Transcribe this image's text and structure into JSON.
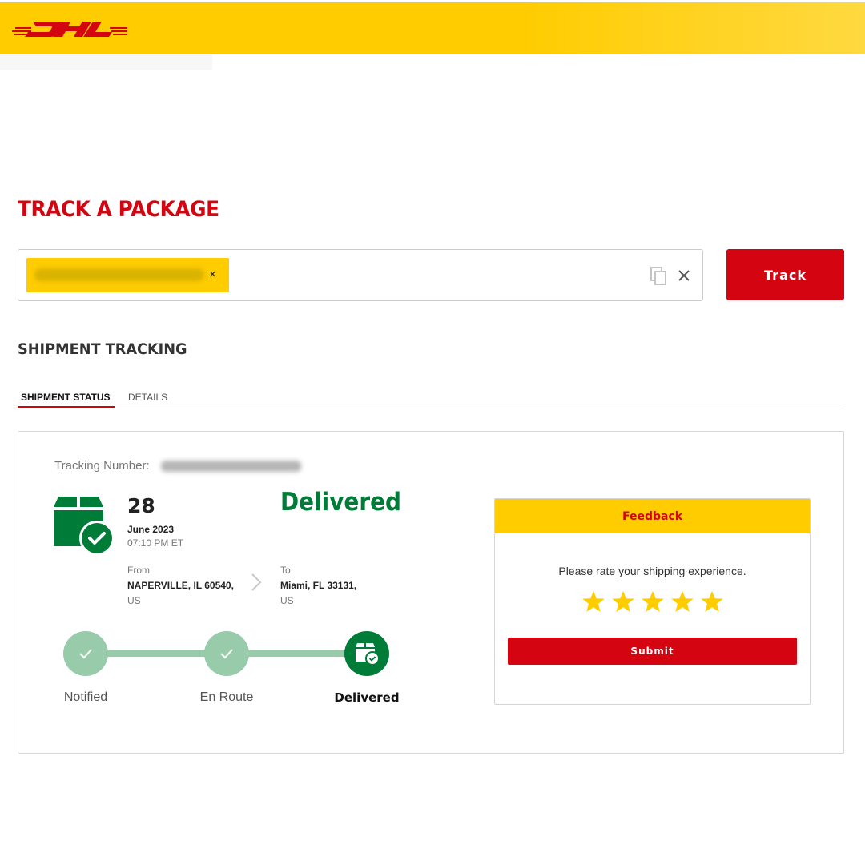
{
  "header": {
    "brand": "DHL",
    "brand_color": "#d40511",
    "bar_color": "#ffcc00"
  },
  "page": {
    "title": "TRACK A PACKAGE"
  },
  "search": {
    "chip_value": "[redacted tracking number]",
    "chip_remove_icon": "×",
    "copy_icon": "copy-icon",
    "clear_icon": "close-icon",
    "track_label": "Track"
  },
  "shipment": {
    "section_title": "SHIPMENT TRACKING",
    "tabs": [
      {
        "label": "SHIPMENT STATUS",
        "active": true
      },
      {
        "label": "DETAILS",
        "active": false
      }
    ],
    "tracking_label": "Tracking Number:",
    "tracking_value": "[redacted tracking number]",
    "date_day": "28",
    "date_month_year": "June 2023",
    "time": "07:10 PM ET",
    "status": "Delivered",
    "status_color": "#007c39",
    "from": {
      "label": "From",
      "city": "NAPERVILLE, IL 60540,",
      "country": "US"
    },
    "to": {
      "label": "To",
      "city": "Miami, FL 33131,",
      "country": "US"
    },
    "progress": {
      "completed_steps": 3,
      "total_steps": 3,
      "steps": [
        {
          "label": "Notified",
          "state": "complete"
        },
        {
          "label": "En Route",
          "state": "complete"
        },
        {
          "label": "Delivered",
          "state": "current"
        }
      ]
    }
  },
  "feedback": {
    "title": "Feedback",
    "prompt": "Please rate your shipping experience.",
    "rating": 5,
    "max_rating": 5,
    "star_color": "#ffcc00",
    "submit_label": "Submit"
  }
}
